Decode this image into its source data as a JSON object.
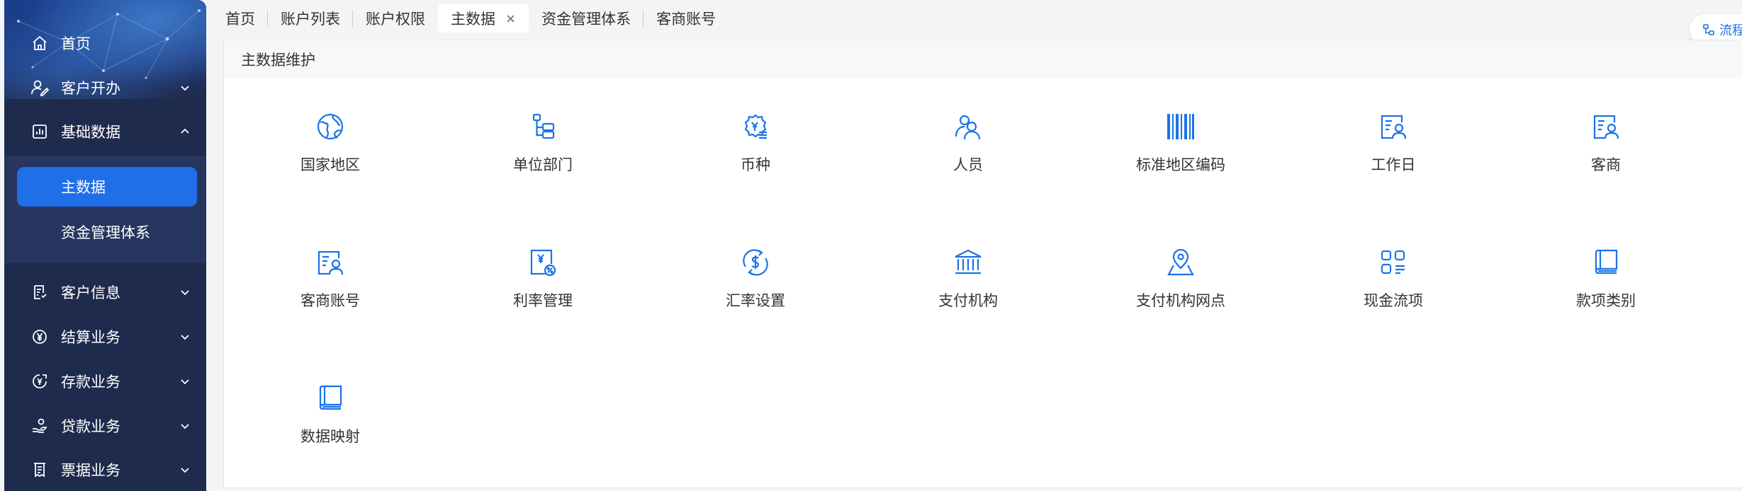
{
  "sidebar": {
    "items": [
      {
        "label": "首页",
        "icon": "home-icon"
      },
      {
        "label": "客户开办",
        "icon": "user-edit-icon"
      },
      {
        "label": "基础数据",
        "icon": "data-chart-icon"
      },
      {
        "label": "客户信息",
        "icon": "document-list-icon"
      },
      {
        "label": "结算业务",
        "icon": "yen-circle-icon"
      },
      {
        "label": "存款业务",
        "icon": "deposit-icon"
      },
      {
        "label": "贷款业务",
        "icon": "loan-hand-icon"
      },
      {
        "label": "票据业务",
        "icon": "bill-icon"
      }
    ],
    "submenu": [
      {
        "label": "主数据",
        "active": true
      },
      {
        "label": "资金管理体系",
        "active": false
      }
    ]
  },
  "tabs": [
    {
      "label": "首页"
    },
    {
      "label": "账户列表"
    },
    {
      "label": "账户权限"
    },
    {
      "label": "主数据",
      "active": true,
      "close": "×"
    },
    {
      "label": "资金管理体系"
    },
    {
      "label": "客商账号"
    }
  ],
  "float_button": {
    "label": "流程",
    "icon": "flow-icon"
  },
  "panel": {
    "title": "主数据维护",
    "items": [
      {
        "label": "国家地区",
        "icon": "globe-icon"
      },
      {
        "label": "单位部门",
        "icon": "org-tree-icon"
      },
      {
        "label": "币种",
        "icon": "currency-gear-icon"
      },
      {
        "label": "人员",
        "icon": "people-icon"
      },
      {
        "label": "标准地区编码",
        "icon": "barcode-icon"
      },
      {
        "label": "工作日",
        "icon": "id-card-icon"
      },
      {
        "label": "客商",
        "icon": "merchant-card-icon"
      },
      {
        "label": "客商账号",
        "icon": "merchant-account-icon"
      },
      {
        "label": "利率管理",
        "icon": "interest-rate-icon"
      },
      {
        "label": "汇率设置",
        "icon": "dollar-exchange-icon"
      },
      {
        "label": "支付机构",
        "icon": "bank-icon"
      },
      {
        "label": "支付机构网点",
        "icon": "map-pin-icon"
      },
      {
        "label": "现金流项",
        "icon": "grid-apps-icon"
      },
      {
        "label": "款项类别",
        "icon": "book-icon"
      },
      {
        "label": "数据映射",
        "icon": "data-book-icon"
      }
    ]
  },
  "colors": {
    "accent": "#1f6fe8",
    "sidebar_bg": "#1f2b4d",
    "icon_blue": "#1a73e8"
  }
}
